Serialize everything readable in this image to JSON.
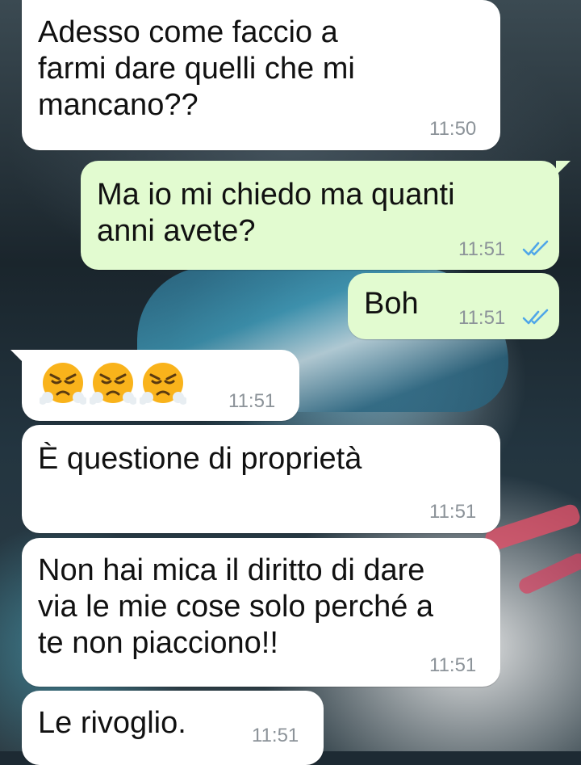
{
  "messages": [
    {
      "direction": "in",
      "text": "Adesso come faccio a\nfarmi dare quelli che mi\nmancano??",
      "time": "11:50"
    },
    {
      "direction": "out",
      "text": "Ma io mi chiedo ma quanti\nanni avete?",
      "time": "11:51",
      "status": "read"
    },
    {
      "direction": "out",
      "text": "Boh",
      "time": "11:51",
      "status": "read"
    },
    {
      "direction": "in",
      "emoji": [
        "face-with-steam-from-nose",
        "face-with-steam-from-nose",
        "face-with-steam-from-nose"
      ],
      "time": "11:51"
    },
    {
      "direction": "in",
      "text": "È questione di proprietà",
      "time": "11:51"
    },
    {
      "direction": "in",
      "text": "Non hai mica il diritto di dare\nvia le mie cose solo perché a\nte non piacciono!!",
      "time": "11:51"
    },
    {
      "direction": "in",
      "text": "Le rivoglio.",
      "time": "11:51"
    }
  ],
  "colors": {
    "incoming_bubble": "#ffffff",
    "outgoing_bubble": "#e2fbd0",
    "read_ticks": "#4fa6e8",
    "timestamp": "#8c9399"
  }
}
